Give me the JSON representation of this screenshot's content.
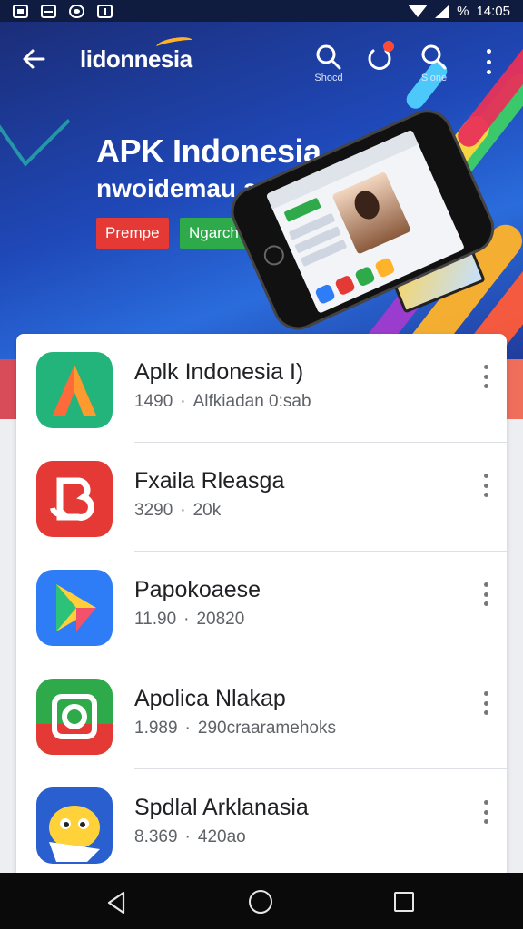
{
  "status_bar": {
    "battery_text": "%",
    "time": "14:05"
  },
  "header": {
    "title": "lidonnesia",
    "actions": [
      {
        "label": "Shocd",
        "icon": "search-icon"
      },
      {
        "label": "",
        "icon": "share-icon"
      },
      {
        "label": "Sione",
        "icon": "search-icon"
      }
    ]
  },
  "hero": {
    "headline": "APK Indonesia",
    "subheadline": "nwoidemau a",
    "primary_button": "Prempe",
    "secondary_button": "Ngarch"
  },
  "apps": [
    {
      "name": "Aplk Indonesia I)",
      "version": "1490",
      "meta": "Alfkiadan 0:sab",
      "icon": "apk-logo-icon"
    },
    {
      "name": "Fxaila Rleasga",
      "version": "3290",
      "meta": "20k",
      "icon": "b-logo-icon"
    },
    {
      "name": "Papokoaese",
      "version": "11.90",
      "meta": "20820",
      "icon": "play-triangle-icon"
    },
    {
      "name": "Apolica Nlakap",
      "version": "1.989",
      "meta": "290craaramehoks",
      "icon": "camera-logo-icon"
    },
    {
      "name": "Spdlal Arklanasia",
      "version": "8.369",
      "meta": "420ao",
      "icon": "mascot-icon"
    }
  ],
  "colors": {
    "hero_blue": "#1f48b8",
    "primary_red": "#e53935",
    "secondary_green": "#2eaa4a",
    "nav_black": "#0a0a0a"
  }
}
